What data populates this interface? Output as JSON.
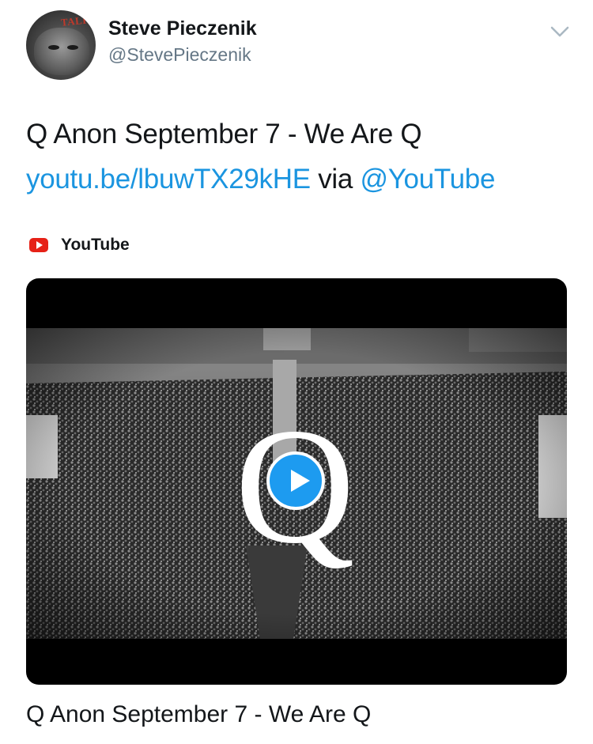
{
  "author": {
    "name": "Steve Pieczenik",
    "handle": "@StevePieczenik",
    "avatar_hat_text": "TALK"
  },
  "icons": {
    "menu": "chevron-down-icon",
    "source": "youtube-logo-icon",
    "play": "play-icon"
  },
  "tweet": {
    "text": "Q Anon September 7 - We Are Q",
    "link_text": "youtu.be/lbuwTX29kHE",
    "via_text": " via ",
    "mention_text": "@YouTube"
  },
  "card": {
    "source_label": "YouTube",
    "overlay_letter": "Q",
    "title": "Q Anon September 7 - We Are Q"
  },
  "colors": {
    "link": "#1b95e0",
    "handle": "#657786",
    "youtube_red": "#e62117",
    "play_button": "#1d9bf0"
  }
}
